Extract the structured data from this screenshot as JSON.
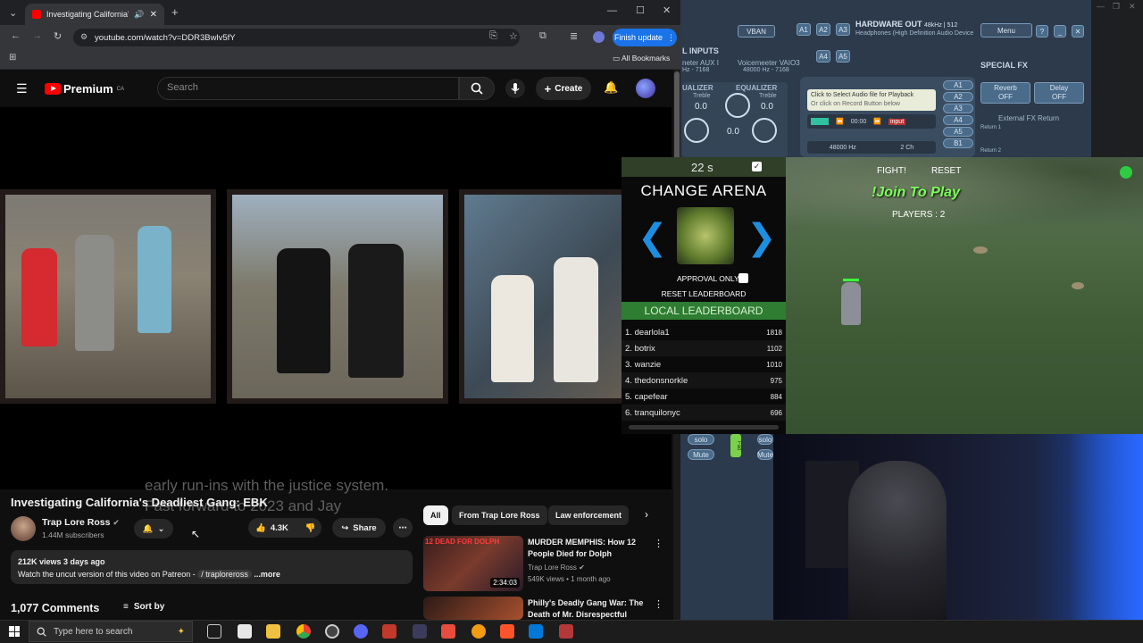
{
  "browser": {
    "tab_title": "Investigating California's De...",
    "url": "youtube.com/watch?v=DDR3Bwlv5fY",
    "update_button": "Finish update",
    "bookmarks": "All Bookmarks"
  },
  "youtube": {
    "logo_text": "Premium",
    "logo_region": "CA",
    "search_placeholder": "Search",
    "create_label": "Create",
    "subtitle_line1": "early run-ins with the justice system.",
    "subtitle_line2": "Fast forward to 2023 and Jay",
    "video_title": "Investigating California's Deadliest Gang: EBK",
    "channel_name": "Trap Lore Ross",
    "channel_subs": "1.44M subscribers",
    "likes": "4.3K",
    "share_label": "Share",
    "desc_meta": "212K views  3 days ago",
    "desc_text": "Watch the uncut version of this video on Patreon -",
    "desc_link": "/ traploreross",
    "desc_more": "...more",
    "comments_count": "1,077 Comments",
    "sort_label": "Sort by",
    "chips": [
      "All",
      "From Trap Lore Ross",
      "Law enforcement"
    ],
    "related": [
      {
        "title": "MURDER MEMPHIS: How 12 People Died for Dolph",
        "channel": "Trap Lore Ross",
        "meta": "549K views • 1 month ago",
        "duration": "2:34:03",
        "thumb_text": "12 DEAD FOR DOLPH"
      },
      {
        "title": "Philly's Deadly Gang War: The Death of Mr. Disrespectful",
        "channel": "",
        "meta": "",
        "duration": "",
        "thumb_text": ""
      }
    ]
  },
  "voicemeeter": {
    "vban": "VBAN",
    "buses": [
      "A1",
      "A2",
      "A3",
      "A4",
      "A5"
    ],
    "hw_out_title": "HARDWARE OUT",
    "hw_out_rate": "48kHz | 512",
    "hw_out_device": "Headphones (High Definition Audio Device",
    "menu": "Menu",
    "inputs": "L INPUTS",
    "input1": "neter AUX I",
    "input1_sub": "Hz - 7168",
    "input2": "Voicemeeter VAIO3",
    "input2_sub": "48000 Hz - 7168",
    "equalizer": "EQUALIZER",
    "equalizer_left": "UALIZER",
    "treble": "Treble",
    "knob_value": "0.0",
    "playback_hint1": "Click to Select Audio file for Playback",
    "playback_hint2": "Or click on Record Button below",
    "time": "00:00",
    "input_tag": "input",
    "sample_rate": "48000 Hz",
    "channels": "2 Ch",
    "special_fx": "SPECIAL FX",
    "reverb": "Reverb",
    "delay": "Delay",
    "off": "OFF",
    "external_fx": "External FX Return",
    "return1": "Return 1",
    "return2": "Return 2",
    "side_buses": [
      "A1",
      "A2",
      "A3",
      "A4",
      "A5",
      "B1"
    ],
    "solo": "solo",
    "mute": "Mute",
    "fader": "Fad"
  },
  "arena": {
    "timer": "22 s",
    "title": "CHANGE ARENA",
    "approval": "APPROVAL ONLY",
    "reset_lb": "RESET LEADERBOARD",
    "local_lb": "LOCAL LEADERBOARD",
    "leaderboard": [
      {
        "rank": "1.",
        "name": "dearlola1",
        "score": "1818"
      },
      {
        "rank": "2.",
        "name": "botrix",
        "score": "1102"
      },
      {
        "rank": "3.",
        "name": "wanzie",
        "score": "1010"
      },
      {
        "rank": "4.",
        "name": "thedonsnorkle",
        "score": "975"
      },
      {
        "rank": "5.",
        "name": "capefear",
        "score": "884"
      },
      {
        "rank": "6.",
        "name": "tranquilonyc",
        "score": "696"
      }
    ]
  },
  "game": {
    "fight": "FIGHT!",
    "reset": "RESET",
    "join": "!Join To Play",
    "players": "PLAYERS : 2"
  },
  "taskbar": {
    "search_placeholder": "Type here to search"
  },
  "colors": {
    "yt_red": "#ff0000",
    "lb_green": "#2e7d32",
    "join_green": "#7dff5a",
    "vm_blue": "#2c3a4b"
  }
}
